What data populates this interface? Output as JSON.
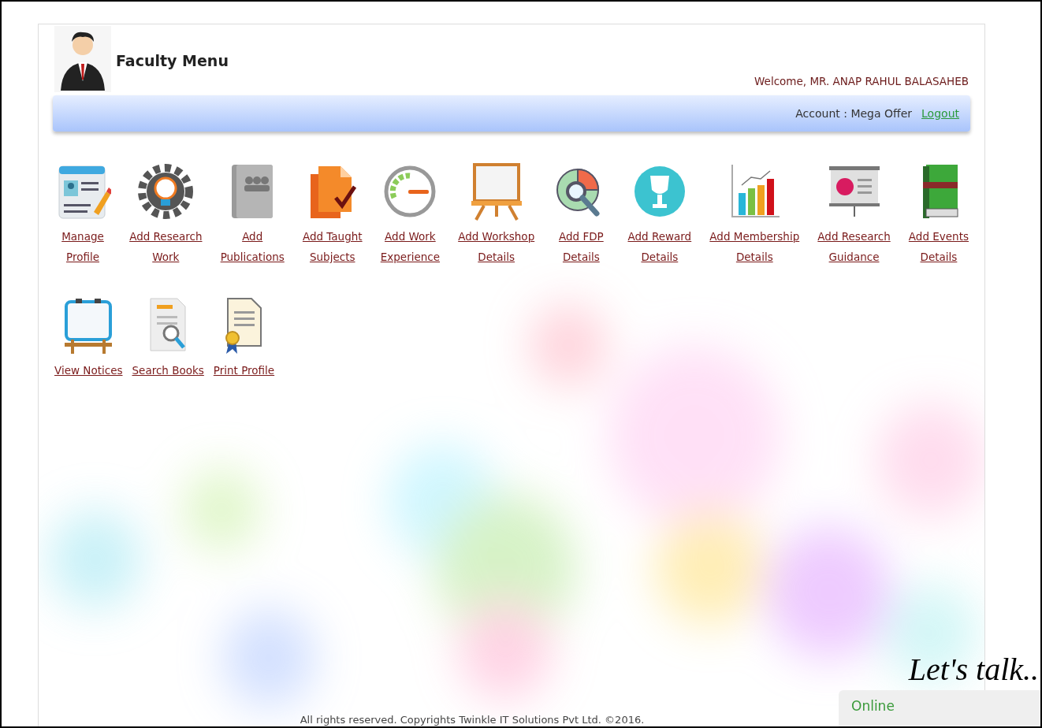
{
  "header": {
    "title": "Faculty Menu",
    "welcome": "Welcome, MR. ANAP RAHUL BALASAHEB"
  },
  "account_bar": {
    "account": "Account : Mega Offer",
    "logout": "Logout"
  },
  "menu_rows": [
    [
      {
        "kind": "profile",
        "label": [
          "Manage",
          "Profile"
        ]
      },
      {
        "kind": "gear",
        "label": [
          "Add Research",
          "Work"
        ]
      },
      {
        "kind": "contacts",
        "label": [
          "Add",
          "Publications"
        ]
      },
      {
        "kind": "document",
        "label": [
          "Add Taught",
          "Subjects"
        ]
      },
      {
        "kind": "gauge",
        "label": [
          "Add Work",
          "Experience"
        ]
      },
      {
        "kind": "easel",
        "label": [
          "Add Workshop",
          "Details"
        ]
      },
      {
        "kind": "magnifier",
        "label": [
          "Add FDP",
          "Details"
        ]
      },
      {
        "kind": "trophy",
        "label": [
          "Add Reward",
          "Details"
        ]
      },
      {
        "kind": "barchart",
        "label": [
          "Add Membership",
          "Details"
        ]
      },
      {
        "kind": "presentation",
        "label": [
          "Add Research",
          "Guidance"
        ]
      },
      {
        "kind": "books",
        "label": [
          "Add Events",
          "Details"
        ]
      }
    ],
    [
      {
        "kind": "board",
        "label": [
          "View Notices"
        ]
      },
      {
        "kind": "search-doc",
        "label": [
          "Search Books"
        ]
      },
      {
        "kind": "certificate",
        "label": [
          "Print Profile"
        ]
      }
    ]
  ],
  "footer": "All rights reserved. Copyrights Twinkle IT Solutions Pvt Ltd. ©2016.",
  "chat": {
    "title": "Let's talk..",
    "status": "Online"
  }
}
